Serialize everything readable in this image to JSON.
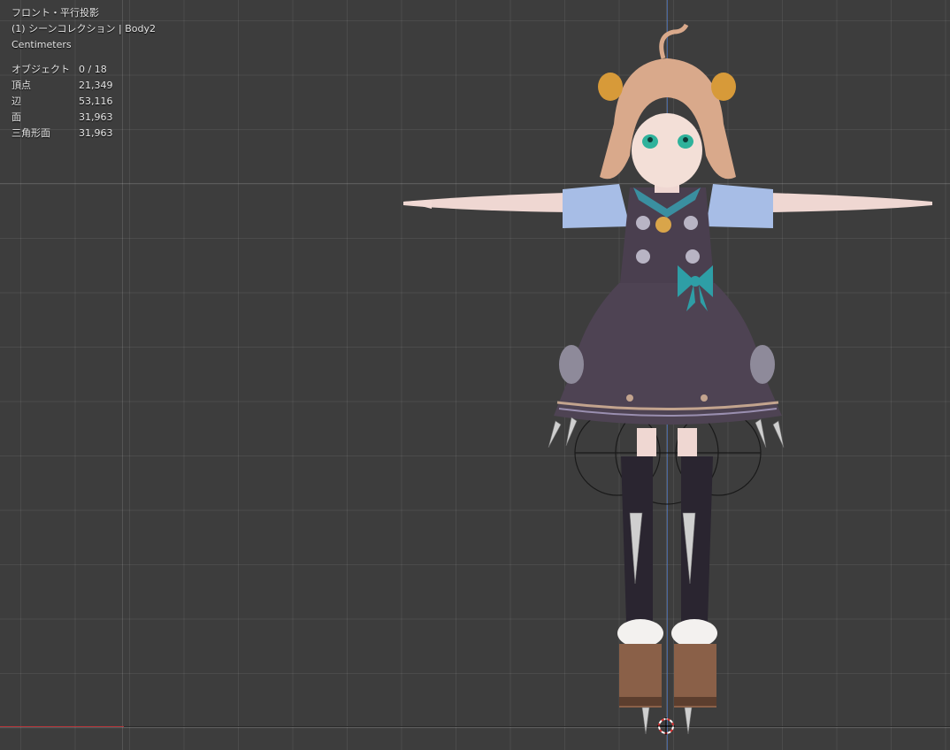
{
  "viewport": {
    "view_name": "フロント・平行投影",
    "collection": "(1) シーンコレクション | Body2",
    "units": "Centimeters"
  },
  "stats": [
    {
      "label": "オブジェクト",
      "value": "0 / 18"
    },
    {
      "label": "頂点",
      "value": "21,349"
    },
    {
      "label": "辺",
      "value": "53,116"
    },
    {
      "label": "面",
      "value": "31,963"
    },
    {
      "label": "三角形面",
      "value": "31,963"
    }
  ],
  "colors": {
    "background": "#3d3d3d",
    "z_axis": "#4a6fb0",
    "x_axis": "#b0353a",
    "text": "#e6e6e6",
    "dress": "#4a3f4f",
    "sleeves": "#a7bde6",
    "hair": "#d9a98b",
    "bow": "#2e9ea6"
  },
  "icons": {
    "cursor": "3d-cursor-icon",
    "model": "character-model-icon"
  }
}
